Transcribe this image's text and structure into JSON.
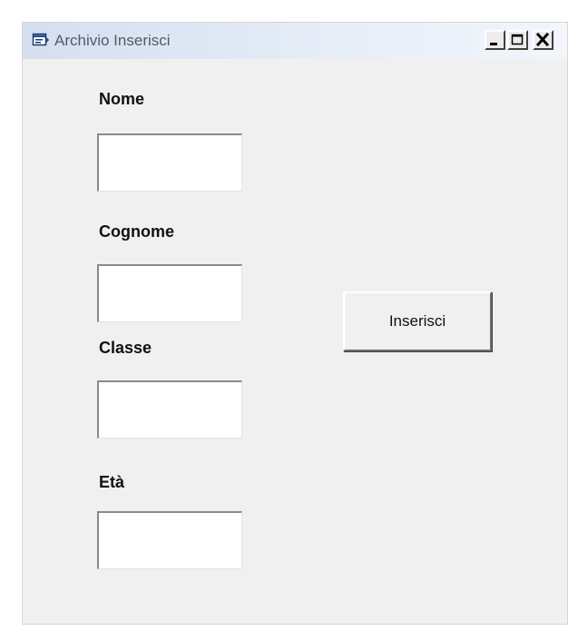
{
  "window": {
    "title": "Archivio Inserisci",
    "icon": "form-icon",
    "controls": [
      "minimize-icon",
      "maximize-icon",
      "close-icon"
    ]
  },
  "form": {
    "fields": [
      {
        "label": "Nome",
        "value": ""
      },
      {
        "label": "Cognome",
        "value": ""
      },
      {
        "label": "Classe",
        "value": ""
      },
      {
        "label": "Età",
        "value": ""
      }
    ],
    "submit_label": "Inserisci"
  },
  "colors": {
    "window_bg": "#f0f0f0",
    "titlebar_start": "#d3dff0",
    "titlebar_end": "#f2f6fb",
    "title_text": "#555a66"
  }
}
